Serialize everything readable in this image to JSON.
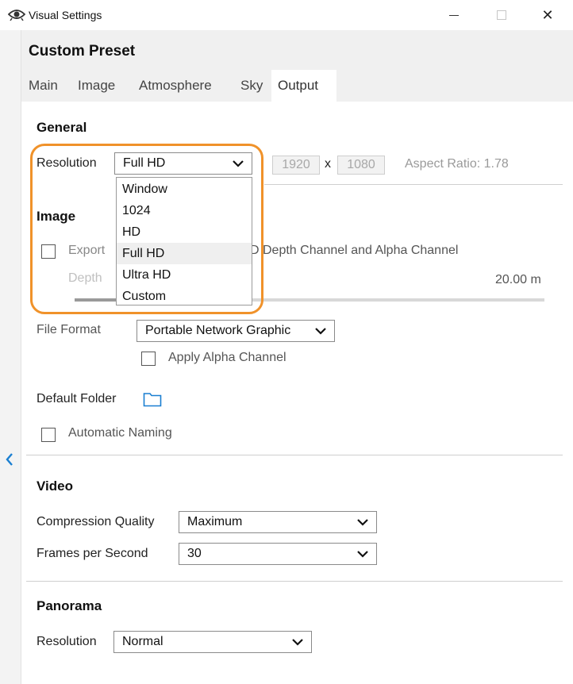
{
  "window": {
    "title": "Visual Settings",
    "minimize_icon": "minimize-icon",
    "maximize_icon": "maximize-icon",
    "close_icon": "close-icon",
    "close_glyph": "✕"
  },
  "preset": {
    "title": "Custom Preset"
  },
  "tabs": [
    {
      "label": "Main"
    },
    {
      "label": "Image"
    },
    {
      "label": "Atmosphere"
    },
    {
      "label": "Sky"
    },
    {
      "label": "Output",
      "active": true
    }
  ],
  "general": {
    "title": "General",
    "resolution_label": "Resolution",
    "resolution_value": "Full HD",
    "width": "1920",
    "x_sep": "x",
    "height": "1080",
    "aspect_ratio": "Aspect Ratio: 1.78",
    "dropdown_options": [
      "Window",
      "1024",
      "HD",
      "Full HD",
      "Ultra HD",
      "Custom"
    ],
    "selected_option": "Full HD"
  },
  "image": {
    "title": "Image",
    "export_label_left": "Export",
    "export_label_right": "D Depth Channel and Alpha Channel",
    "depth_label": "Depth",
    "depth_value": "20.00 m",
    "depth_fraction": 0.09,
    "file_format_label": "File Format",
    "file_format_value": "Portable Network Graphic",
    "apply_alpha_label": "Apply Alpha Channel",
    "default_folder_label": "Default Folder",
    "auto_naming_label": "Automatic Naming"
  },
  "video": {
    "title": "Video",
    "compression_label": "Compression Quality",
    "compression_value": "Maximum",
    "fps_label": "Frames per Second",
    "fps_value": "30"
  },
  "panorama": {
    "title": "Panorama",
    "resolution_label": "Resolution",
    "resolution_value": "Normal"
  },
  "colors": {
    "accent": "#1a7fd1",
    "highlight": "#f0922a",
    "header_bg": "#f0f0f0"
  }
}
